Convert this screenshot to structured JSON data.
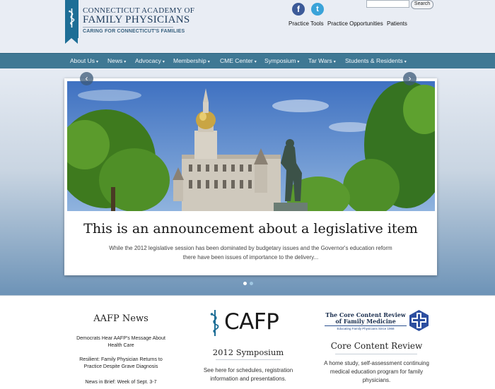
{
  "header": {
    "org_line1": "CONNECTICUT ACADEMY OF",
    "org_line2": "FAMILY PHYSICIANS",
    "tagline": "CARING FOR CONNECTICUT'S FAMILIES",
    "search_button": "Search",
    "search_placeholder": "",
    "social": {
      "facebook_glyph": "f",
      "twitter_glyph": "t"
    },
    "util_links": [
      "Practice Tools",
      "Practice Opportunities",
      "Patients"
    ]
  },
  "nav": {
    "items": [
      "About Us",
      "News",
      "Advocacy",
      "Membership",
      "CME Center",
      "Symposium",
      "Tar Wars",
      "Students & Residents"
    ]
  },
  "slider": {
    "headline": "This is an announcement about a legislative item",
    "text": "While the 2012 legislative session has been dominated by budgetary issues and the Governor's education reform there have been issues of importance to the delivery...",
    "prev_icon": "chevron-left-icon",
    "next_icon": "chevron-right-icon",
    "slide_count": 2,
    "active_slide": 1
  },
  "bottom": {
    "news": {
      "title": "AAFP News",
      "items": [
        "Democrats Hear AAFP's Message About Health Care",
        "Resilient: Family Physician Returns to Practice Despite Grave Diagnosis",
        "News in Brief: Week of Sept. 3-7"
      ]
    },
    "cafp": {
      "logo_text": "CAFP",
      "title": "2012 Symposium",
      "text": "See here for schedules, registration information and presentations."
    },
    "ccr": {
      "logo_line1": "The Core Content Review",
      "logo_line2": "of Family Medicine",
      "logo_line3": "Educating Family Physicians Since 1968",
      "title": "Core Content Review",
      "text": "A home study, self-assessment continuing medical education program for family physicians."
    }
  },
  "colors": {
    "nav_bg": "#3f7894",
    "logo_blue": "#1e6e96",
    "facebook": "#3c5a98",
    "twitter": "#3aa3d9"
  }
}
